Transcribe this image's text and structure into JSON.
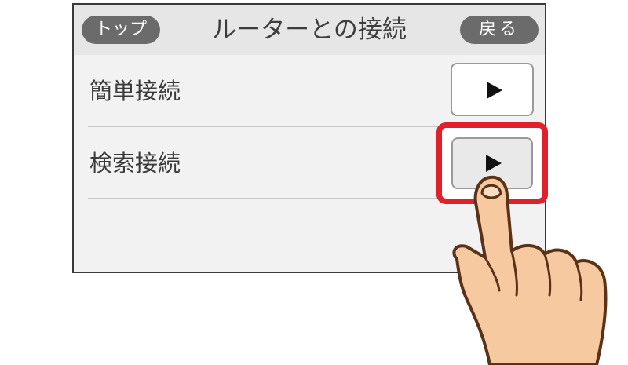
{
  "header": {
    "top_button": "トップ",
    "title": "ルーターとの接続",
    "back_button": "戻る"
  },
  "menu": {
    "items": [
      {
        "label": "簡単接続"
      },
      {
        "label": "検索接続"
      }
    ]
  },
  "colors": {
    "highlight": "#e0202a",
    "pill": "#6b6b6b",
    "hand_fill": "#f6c9a1",
    "hand_outline": "#5a3218"
  },
  "icons": {
    "arrow": "play-arrow-icon",
    "hand": "pointing-hand-icon"
  }
}
